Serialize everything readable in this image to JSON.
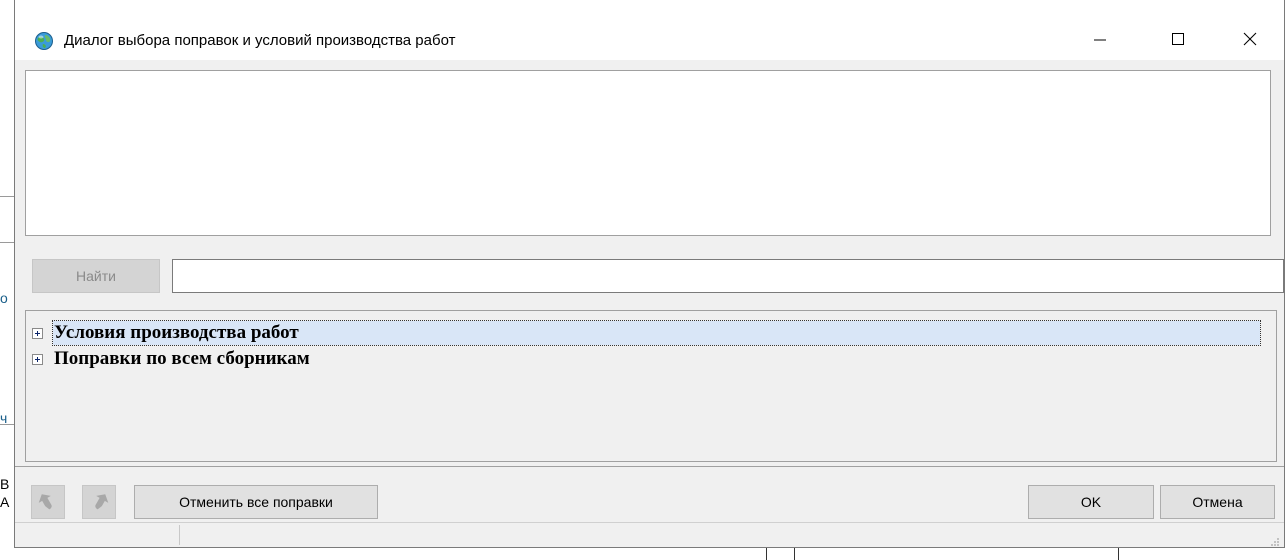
{
  "background": {
    "left_fragments": [
      "о",
      "ч",
      "В",
      "А"
    ]
  },
  "dialog": {
    "title": "Диалог выбора поправок и условий производства работ",
    "icons": {
      "app": "globe-app-icon",
      "minimize": "minimize-icon",
      "maximize": "maximize-icon",
      "close": "close-icon"
    },
    "memo_text": "",
    "find_button": "Найти",
    "search": {
      "value": "",
      "placeholder": ""
    },
    "tree": {
      "items": [
        {
          "label": "Условия производства работ",
          "expanded": false,
          "selected": true
        },
        {
          "label": "Поправки по всем сборникам",
          "expanded": false,
          "selected": false
        }
      ]
    },
    "footer": {
      "back_icon": "arrow-undo-icon",
      "forward_icon": "arrow-redo-icon",
      "reset_all_label": "Отменить все поправки",
      "ok_label": "OK",
      "cancel_label": "Отмена"
    },
    "colors": {
      "selection": "#d9e6f7",
      "dialog_bg": "#f0f0f0",
      "disabled_text": "#8a8a8a"
    }
  }
}
